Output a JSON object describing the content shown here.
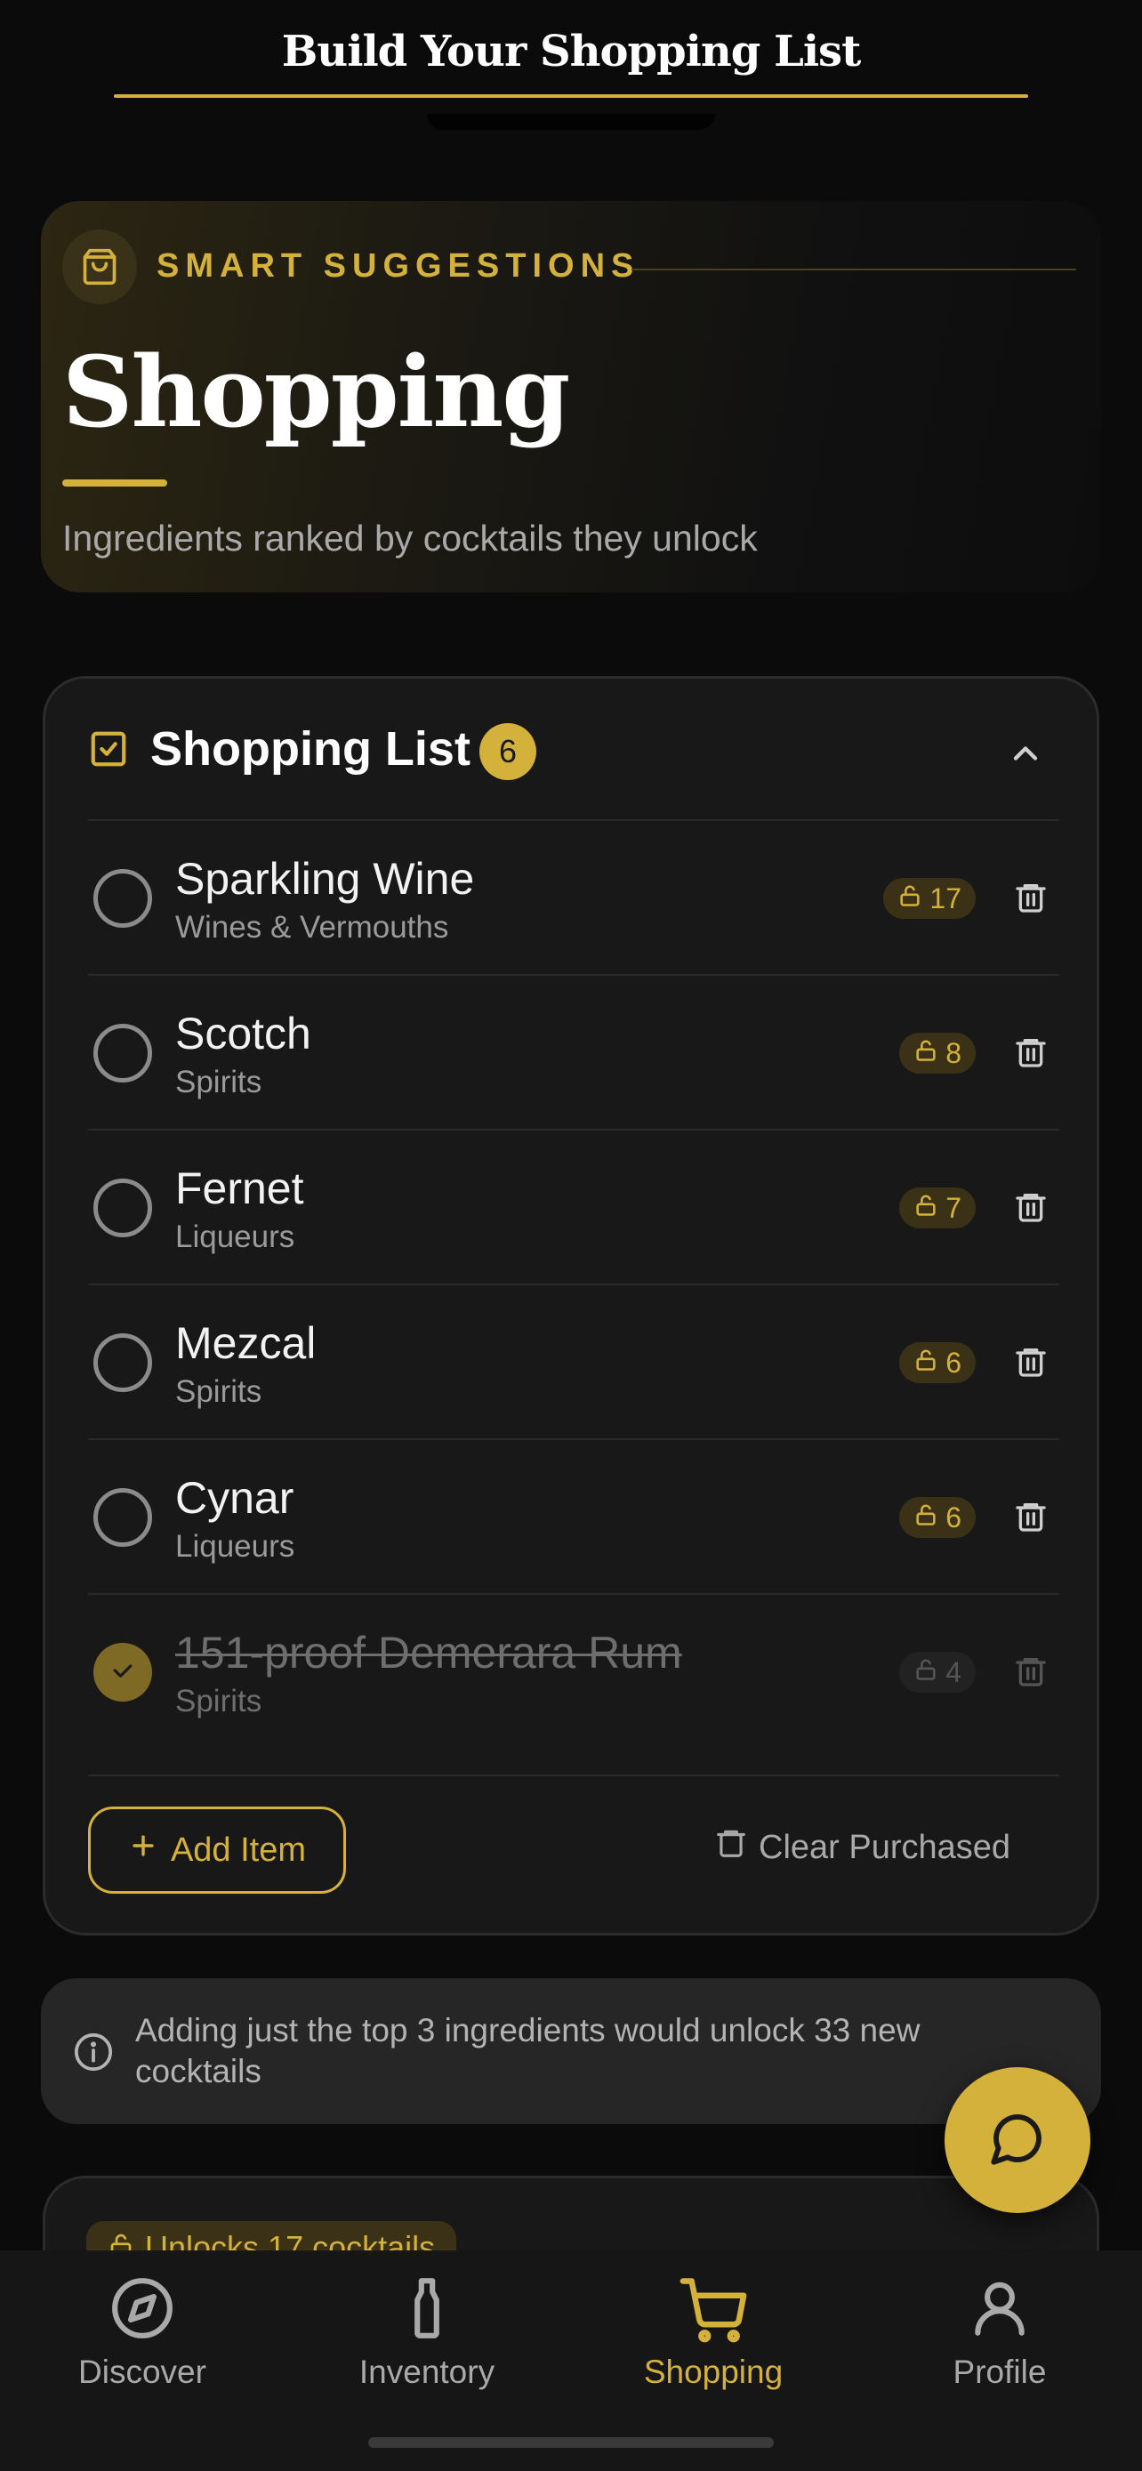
{
  "header": {
    "title": "Build Your Shopping List"
  },
  "hero": {
    "kicker": "SMART SUGGESTIONS",
    "title": "Shopping",
    "subtitle": "Ingredients ranked by cocktails they unlock"
  },
  "shopping_list": {
    "title": "Shopping List",
    "count": "6",
    "items": [
      {
        "name": "Sparkling Wine",
        "category": "Wines & Vermouths",
        "unlocks": "17",
        "purchased": false
      },
      {
        "name": "Scotch",
        "category": "Spirits",
        "unlocks": "8",
        "purchased": false
      },
      {
        "name": "Fernet",
        "category": "Liqueurs",
        "unlocks": "7",
        "purchased": false
      },
      {
        "name": "Mezcal",
        "category": "Spirits",
        "unlocks": "6",
        "purchased": false
      },
      {
        "name": "Cynar",
        "category": "Liqueurs",
        "unlocks": "6",
        "purchased": false
      },
      {
        "name": "151-proof Demerara Rum",
        "category": "Spirits",
        "unlocks": "4",
        "purchased": true
      }
    ],
    "add_label": "Add Item",
    "clear_label": "Clear Purchased"
  },
  "tip": {
    "text": "Adding just the top 3 ingredients would unlock 33 new cocktails"
  },
  "next_card": {
    "badge": "Unlocks 17 cocktails"
  },
  "tabs": [
    {
      "label": "Discover",
      "icon": "compass-icon",
      "active": false
    },
    {
      "label": "Inventory",
      "icon": "bottle-icon",
      "active": false
    },
    {
      "label": "Shopping",
      "icon": "cart-icon",
      "active": true
    },
    {
      "label": "Profile",
      "icon": "user-icon",
      "active": false
    }
  ],
  "colors": {
    "accent": "#d4b13a",
    "background": "#0b0b0b",
    "card": "#181818"
  }
}
